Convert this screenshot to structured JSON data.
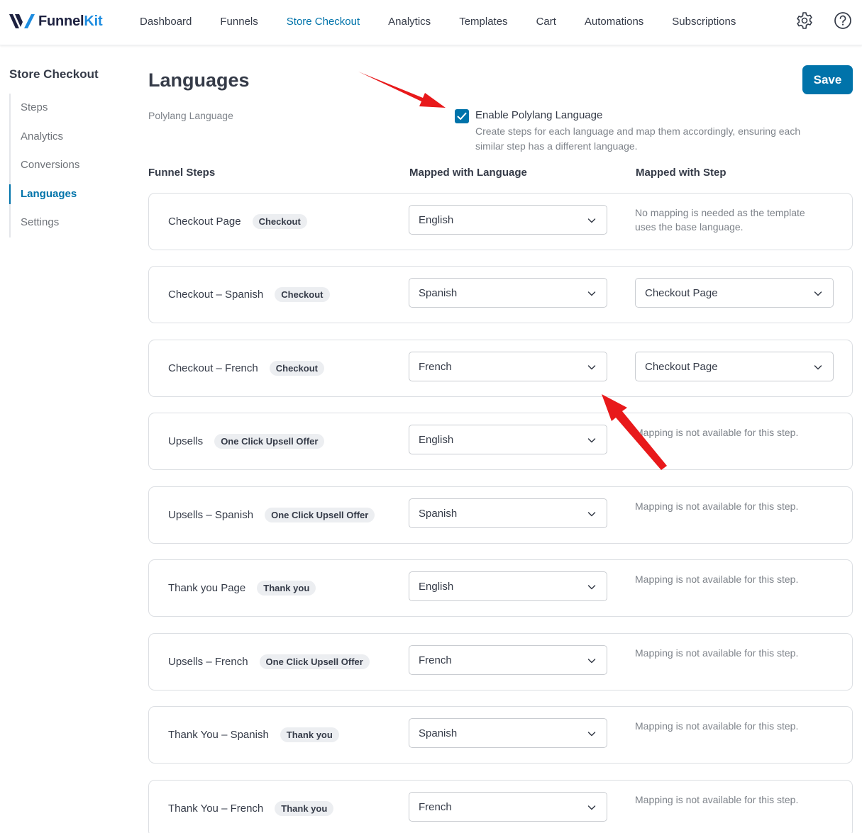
{
  "brand": {
    "name_a": "Funnel",
    "name_b": "Kit"
  },
  "nav": {
    "items": [
      {
        "label": "Dashboard",
        "active": false
      },
      {
        "label": "Funnels",
        "active": false
      },
      {
        "label": "Store Checkout",
        "active": true
      },
      {
        "label": "Analytics",
        "active": false
      },
      {
        "label": "Templates",
        "active": false
      },
      {
        "label": "Cart",
        "active": false
      },
      {
        "label": "Automations",
        "active": false
      },
      {
        "label": "Subscriptions",
        "active": false
      }
    ],
    "icons": [
      "gear-icon",
      "help-icon"
    ]
  },
  "sidebar": {
    "title": "Store Checkout",
    "items": [
      {
        "label": "Steps",
        "active": false
      },
      {
        "label": "Analytics",
        "active": false
      },
      {
        "label": "Conversions",
        "active": false
      },
      {
        "label": "Languages",
        "active": true
      },
      {
        "label": "Settings",
        "active": false
      }
    ]
  },
  "page": {
    "title": "Languages",
    "save_label": "Save",
    "polylang_label": "Polylang Language",
    "checkbox_checked": true,
    "enable_label": "Enable Polylang Language",
    "enable_desc": "Create steps for each language and map them accordingly, ensuring each similar step has a different language."
  },
  "table": {
    "headers": {
      "steps": "Funnel Steps",
      "language": "Mapped with Language",
      "step": "Mapped with Step"
    },
    "rows": [
      {
        "name": "Checkout Page",
        "badge": "Checkout",
        "language": "English",
        "mapped_step": "",
        "note": "No mapping is needed as the template uses the base language."
      },
      {
        "name": "Checkout – Spanish",
        "badge": "Checkout",
        "language": "Spanish",
        "mapped_step": "Checkout Page",
        "note": ""
      },
      {
        "name": "Checkout – French",
        "badge": "Checkout",
        "language": "French",
        "mapped_step": "Checkout Page",
        "note": ""
      },
      {
        "name": "Upsells",
        "badge": "One Click Upsell Offer",
        "language": "English",
        "mapped_step": "",
        "note": "Mapping is not available for this step."
      },
      {
        "name": "Upsells – Spanish",
        "badge": "One Click Upsell Offer",
        "language": "Spanish",
        "mapped_step": "",
        "note": "Mapping is not available for this step."
      },
      {
        "name": "Thank you Page",
        "badge": "Thank you",
        "language": "English",
        "mapped_step": "",
        "note": "Mapping is not available for this step."
      },
      {
        "name": "Upsells – French",
        "badge": "One Click Upsell Offer",
        "language": "French",
        "mapped_step": "",
        "note": "Mapping is not available for this step."
      },
      {
        "name": "Thank You – Spanish",
        "badge": "Thank you",
        "language": "Spanish",
        "mapped_step": "",
        "note": "Mapping is not available for this step."
      },
      {
        "name": "Thank You – French",
        "badge": "Thank you",
        "language": "French",
        "mapped_step": "",
        "note": "Mapping is not available for this step."
      }
    ]
  },
  "colors": {
    "accent": "#0073aa",
    "annotation_arrow": "#e8191b"
  }
}
